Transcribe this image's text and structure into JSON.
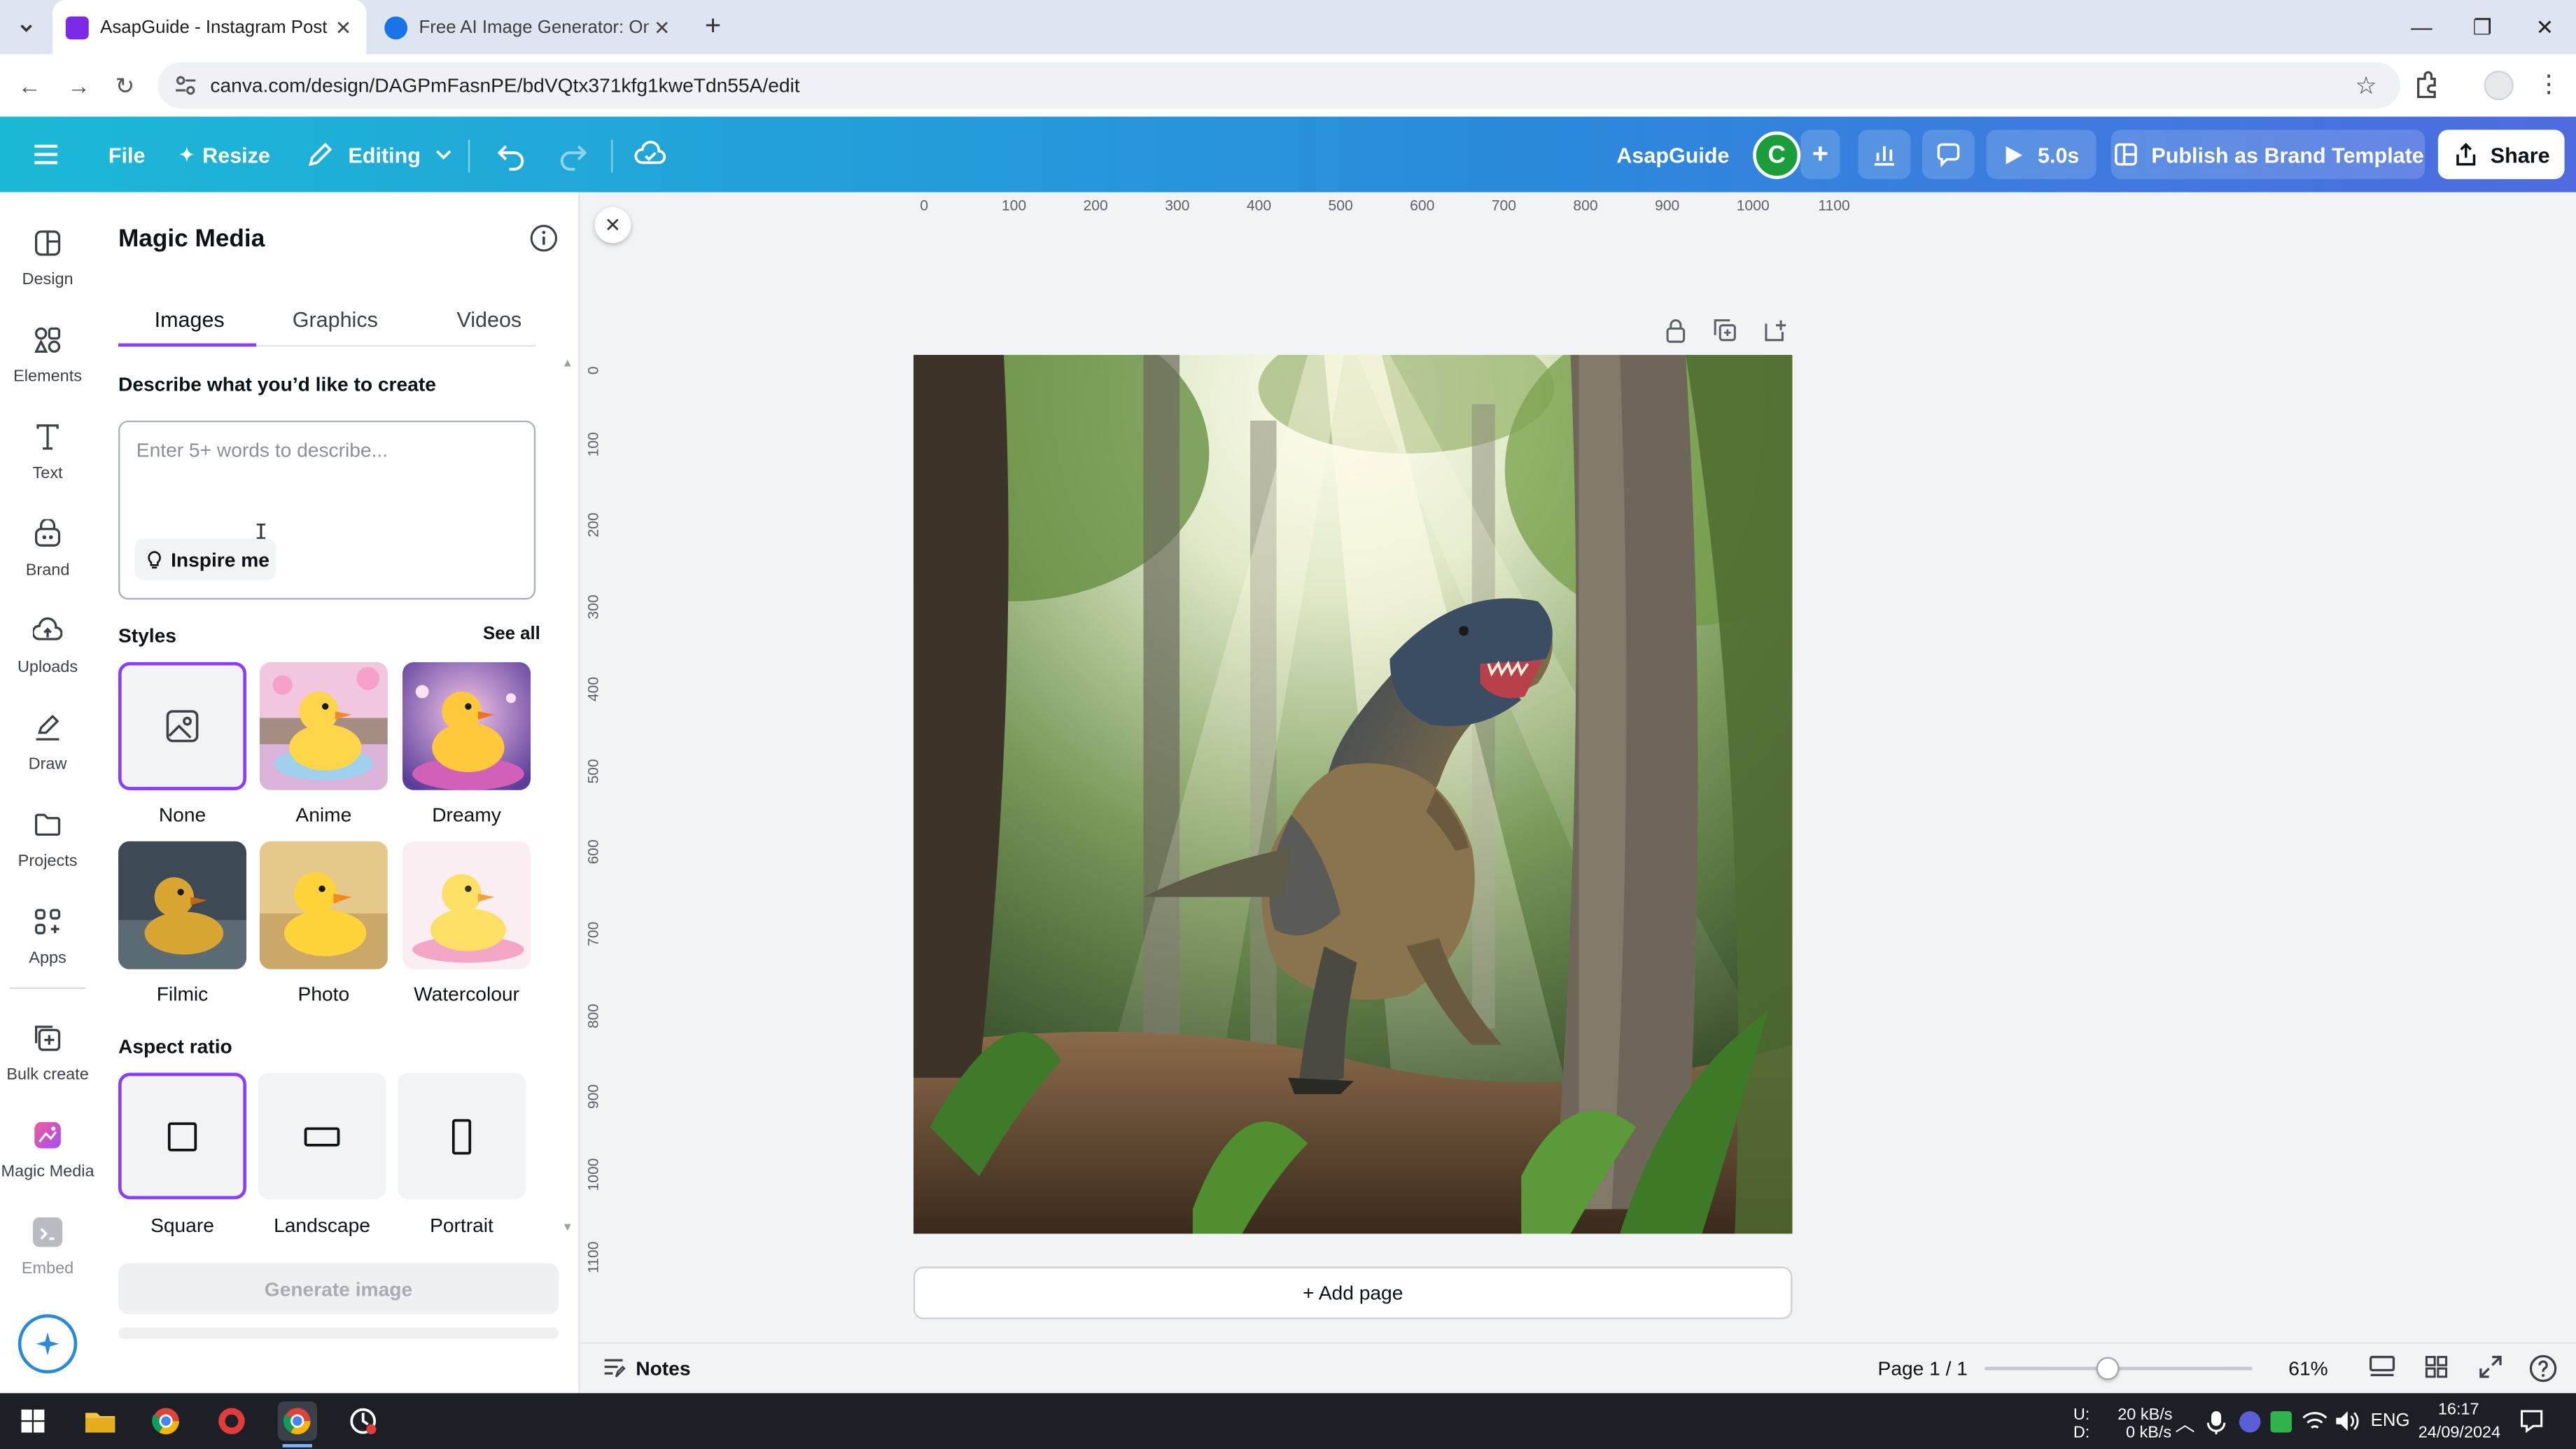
{
  "browser": {
    "tabs": [
      {
        "title": "AsapGuide - Instagram Post",
        "active": true,
        "favicon_color": "#7d2ae8"
      },
      {
        "title": "Free AI Image Generator: Onlin",
        "active": false,
        "favicon_color": "#1a73e8"
      }
    ],
    "new_tab": "+",
    "url": "canva.com/design/DAGPmFasnPE/bdVQtx371kfg1kweTdn55A/edit"
  },
  "topbar": {
    "file": "File",
    "resize": "Resize",
    "editing": "Editing",
    "design_name": "AsapGuide",
    "avatar_initial": "C",
    "avatar_color": "#1a9d3a",
    "present_time": "5.0s",
    "publish": "Publish as Brand Template",
    "share": "Share"
  },
  "rail": [
    {
      "label": "Design",
      "icon": "design-icon"
    },
    {
      "label": "Elements",
      "icon": "elements-icon"
    },
    {
      "label": "Text",
      "icon": "text-icon"
    },
    {
      "label": "Brand",
      "icon": "brand-icon"
    },
    {
      "label": "Uploads",
      "icon": "uploads-icon"
    },
    {
      "label": "Draw",
      "icon": "draw-icon"
    },
    {
      "label": "Projects",
      "icon": "projects-icon"
    },
    {
      "label": "Apps",
      "icon": "apps-icon"
    },
    {
      "label": "Bulk create",
      "icon": "bulk-create-icon"
    },
    {
      "label": "Magic Media",
      "icon": "magic-media-icon"
    },
    {
      "label": "Embed",
      "icon": "embed-icon"
    }
  ],
  "panel": {
    "title": "Magic Media",
    "tabs": [
      "Images",
      "Graphics",
      "Videos"
    ],
    "active_tab": "Images",
    "describe_label": "Describe what you’d like to create",
    "prompt_placeholder": "Enter 5+ words to describe...",
    "inspire": "Inspire me",
    "styles_label": "Styles",
    "see_all": "See all",
    "styles": [
      "None",
      "Anime",
      "Dreamy",
      "Filmic",
      "Photo",
      "Watercolour"
    ],
    "selected_style": "None",
    "aspect_label": "Aspect ratio",
    "aspects": [
      "Square",
      "Landscape",
      "Portrait"
    ],
    "selected_aspect": "Square",
    "generate": "Generate image"
  },
  "canvas": {
    "ruler_top": [
      "0",
      "100",
      "200",
      "300",
      "400",
      "500",
      "600",
      "700",
      "800",
      "900",
      "1000",
      "1100"
    ],
    "ruler_left": [
      "0",
      "100",
      "200",
      "300",
      "400",
      "500",
      "600",
      "700",
      "800",
      "900",
      "1000",
      "1100"
    ],
    "add_page": "+ Add page"
  },
  "status": {
    "notes": "Notes",
    "page": "Page 1 / 1",
    "zoom": "61%",
    "zoom_fraction": 0.46
  },
  "taskbar": {
    "net_up_label": "U:",
    "net_down_label": "D:",
    "net_up": "20 kB/s",
    "net_down": "0 kB/s",
    "lang": "ENG",
    "time": "16:17",
    "date": "24/09/2024"
  }
}
